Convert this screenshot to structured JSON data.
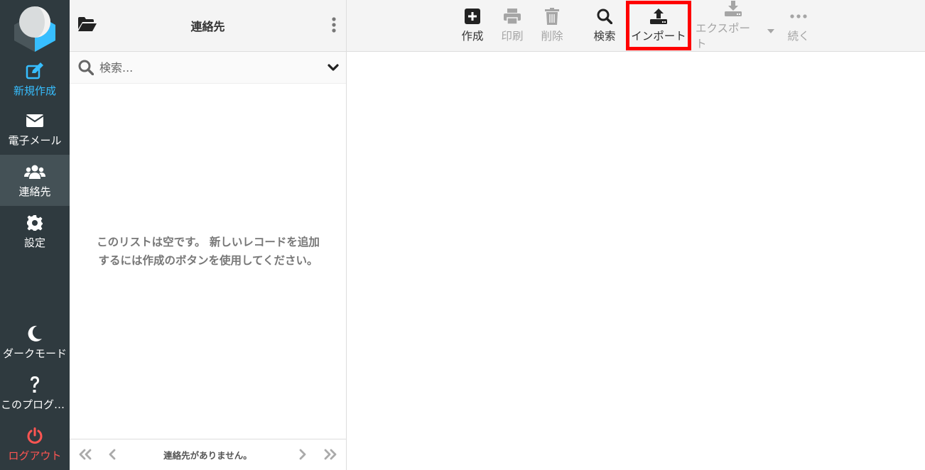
{
  "nav": {
    "items": [
      {
        "label": "新規作成",
        "icon": "compose-icon"
      },
      {
        "label": "電子メール",
        "icon": "envelope-icon"
      },
      {
        "label": "連絡先",
        "icon": "users-icon"
      },
      {
        "label": "設定",
        "icon": "gear-icon"
      },
      {
        "label": "ダークモード",
        "icon": "moon-icon"
      },
      {
        "label": "このプログラムについて",
        "icon": "question-icon"
      },
      {
        "label": "ログアウト",
        "icon": "power-icon"
      }
    ],
    "colors": {
      "background": "#2f3a3f",
      "active": "#445156",
      "compose": "#37beff",
      "logout": "#ff5552"
    }
  },
  "list": {
    "title": "連絡先",
    "search_placeholder": "検索...",
    "empty_message": "このリストは空です。 新しいレコードを追加するには作成のボタンを使用してください。",
    "pager_text": "連絡先がありません。"
  },
  "toolbar": {
    "create": "作成",
    "print": "印刷",
    "delete": "削除",
    "search": "検索",
    "import": "インポート",
    "export": "エクスポート",
    "more": "続く"
  }
}
